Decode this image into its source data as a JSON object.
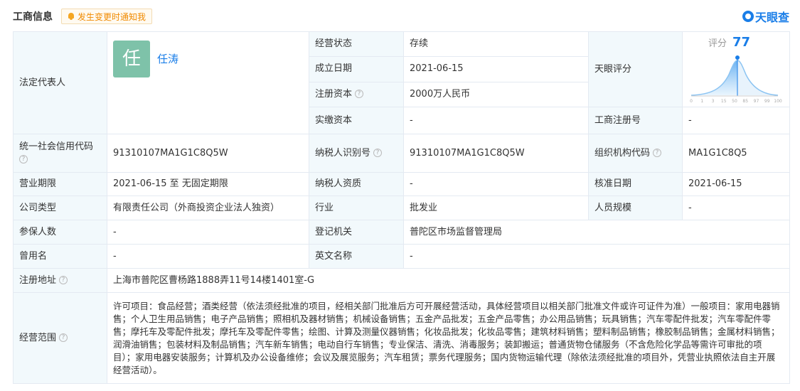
{
  "header": {
    "title": "工商信息",
    "notify": "发生变更时通知我",
    "brand": "天眼查"
  },
  "legal_rep": {
    "label": "法定代表人",
    "avatar_char": "任",
    "name": "任涛"
  },
  "score": {
    "label": "天眼评分",
    "prefix": "评分",
    "value": 77,
    "axis": [
      "0",
      "1",
      "3",
      "15",
      "50",
      "85",
      "97",
      "99",
      "100"
    ]
  },
  "fields": {
    "status_label": "经营状态",
    "status": "存续",
    "founded_label": "成立日期",
    "founded": "2021-06-15",
    "capital_label": "注册资本",
    "capital": "2000万人民币",
    "paid_label": "实缴资本",
    "paid": "-",
    "regno_label": "工商注册号",
    "regno": "-",
    "credit_label": "统一社会信用代码",
    "credit": "91310107MA1G1C8Q5W",
    "taxid_label": "纳税人识别号",
    "taxid": "91310107MA1G1C8Q5W",
    "orgcode_label": "组织机构代码",
    "orgcode": "MA1G1C8Q5",
    "term_label": "营业期限",
    "term": "2021-06-15 至 无固定期限",
    "taxqual_label": "纳税人资质",
    "taxqual": "-",
    "approve_label": "核准日期",
    "approve": "2021-06-15",
    "type_label": "公司类型",
    "type": "有限责任公司（外商投资企业法人独资）",
    "industry_label": "行业",
    "industry": "批发业",
    "staff_label": "人员规模",
    "staff": "-",
    "insured_label": "参保人数",
    "insured": "-",
    "authority_label": "登记机关",
    "authority": "普陀区市场监督管理局",
    "former_label": "曾用名",
    "former": "-",
    "english_label": "英文名称",
    "english": "-",
    "address_label": "注册地址",
    "address": "上海市普陀区曹杨路1888弄11号14楼1401室-G",
    "scope_label": "经营范围",
    "scope": "许可项目：食品经营；酒类经营（依法须经批准的项目，经相关部门批准后方可开展经营活动，具体经营项目以相关部门批准文件或许可证件为准）一般项目：家用电器销售；个人卫生用品销售；电子产品销售；照相机及器材销售；机械设备销售；五金产品批发；五金产品零售；办公用品销售；玩具销售；汽车零配件批发；汽车零配件零售；摩托车及零配件批发；摩托车及零配件零售；绘图、计算及测量仪器销售；化妆品批发；化妆品零售；建筑材料销售；塑料制品销售；橡胶制品销售；金属材料销售；润滑油销售；包装材料及制品销售；汽车新车销售；电动自行车销售；专业保洁、清洗、消毒服务；装卸搬运；普通货物仓储服务（不含危险化学品等需许可审批的项目）；家用电器安装服务；计算机及办公设备维修；会议及展览服务；汽车租赁；票务代理服务；国内货物运输代理（除依法须经批准的项目外，凭营业执照依法自主开展经营活动）。"
  }
}
